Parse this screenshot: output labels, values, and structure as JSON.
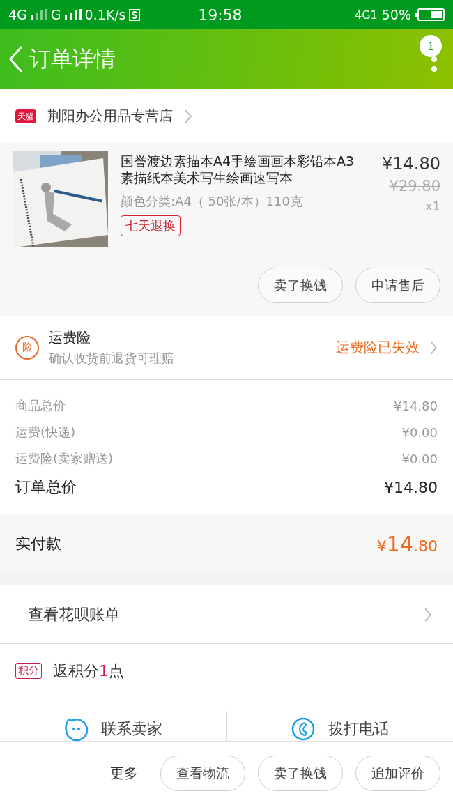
{
  "status_bar": {
    "network_1": "4G",
    "network_2": "G",
    "speed": "0.1K/s",
    "time": "19:58",
    "network_3": "4G1",
    "battery": "50%"
  },
  "header": {
    "title": "订单详情",
    "badge": "1"
  },
  "store": {
    "badge": "天猫",
    "name": "荆阳办公用品专营店"
  },
  "product": {
    "title": "国誉渡边素描本A4手绘画画本彩铅本A3素描纸本美术写生绘画速写本",
    "variant": "颜色分类:A4（ 50张/本）110克",
    "tag": "七天退换",
    "price": "¥14.80",
    "original_price": "¥29.80",
    "quantity": "x1",
    "actions": [
      "卖了换钱",
      "申请售后"
    ]
  },
  "insurance": {
    "icon_text": "险",
    "title": "运费险",
    "subtitle": "确认收货前退货可理赔",
    "status": "运费险已失效"
  },
  "summary": [
    {
      "label": "商品总价",
      "value": "¥14.80",
      "kind": "minor"
    },
    {
      "label": "运费(快递)",
      "value": "¥0.00",
      "kind": "minor"
    },
    {
      "label": "运费险(卖家赠送)",
      "value": "¥0.00",
      "kind": "minor"
    },
    {
      "label": "订单总价",
      "value": "¥14.80",
      "kind": "total"
    }
  ],
  "paid": {
    "label": "实付款",
    "currency": "¥",
    "integer": "14",
    "decimal": ".80"
  },
  "huabei": {
    "label": "查看花呗账单"
  },
  "points": {
    "badge": "积分",
    "prefix": "返积分",
    "count": "1",
    "suffix": "点"
  },
  "contact": [
    {
      "label": "联系卖家",
      "kind": "chat"
    },
    {
      "label": "拨打电话",
      "kind": "phone"
    }
  ],
  "bottom_bar": {
    "more": "更多",
    "buttons": [
      "查看物流",
      "卖了换钱",
      "追加评价"
    ]
  }
}
